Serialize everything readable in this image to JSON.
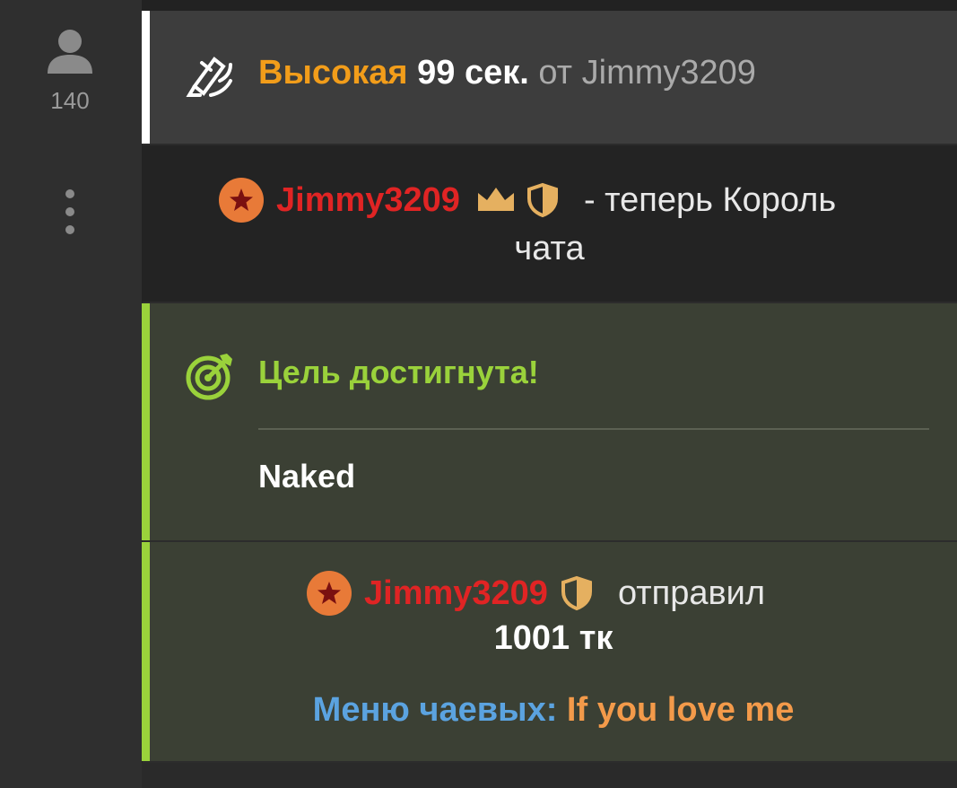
{
  "sidebar": {
    "user_icon": "user-icon",
    "viewer_count": "140",
    "more_icon": "vertical-dots-icon"
  },
  "boost_message": {
    "icon": "rocket-icon",
    "priority": "Высокая",
    "duration": "99 сек.",
    "from_word": "от",
    "username": "Jimmy3209"
  },
  "king_message": {
    "badge_icon": "star-badge-icon",
    "username": "Jimmy3209",
    "crown_icon": "crown-icon",
    "shield_icon": "shield-icon",
    "text_part1": "- теперь Король",
    "text_part2": "чата"
  },
  "goal_message": {
    "icon": "target-icon",
    "title": "Цель достигнута!",
    "description": "Naked"
  },
  "tip_message": {
    "badge_icon": "star-badge-icon",
    "username": "Jimmy3209",
    "shield_icon": "shield-icon",
    "action": "отправил",
    "amount": "1001 тк",
    "menu_label": "Меню чаевых:",
    "menu_item": "If you love me"
  },
  "colors": {
    "priority": "#f29d1a",
    "username_red": "#e02424",
    "goal_green": "#9ad23b",
    "menu_blue": "#5ba3e0",
    "menu_orange": "#f39a4a",
    "gold": "#e5b060"
  }
}
